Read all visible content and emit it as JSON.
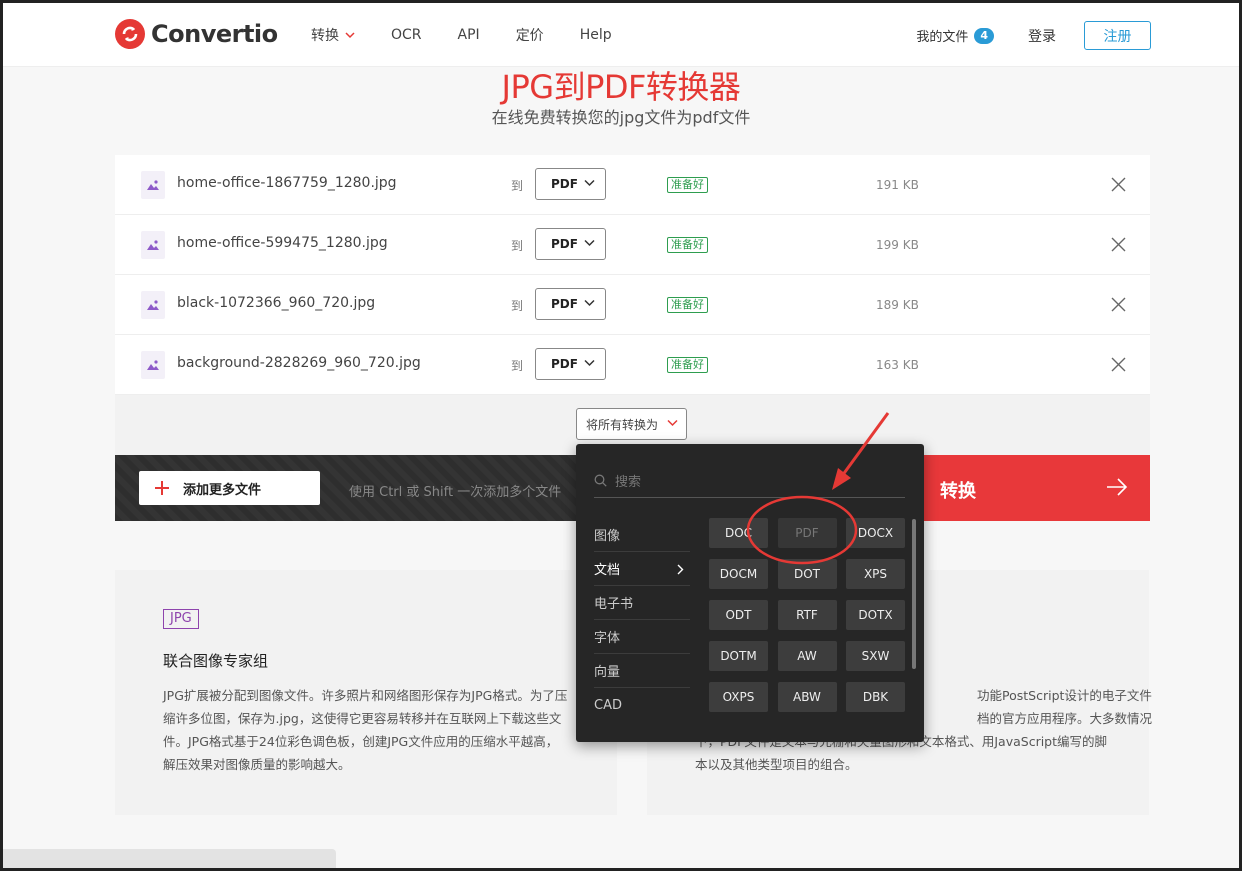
{
  "header": {
    "logo_text": "Convertio",
    "nav": [
      {
        "label": "转换",
        "has_dropdown": true
      },
      {
        "label": "OCR"
      },
      {
        "label": "API"
      },
      {
        "label": "定价"
      },
      {
        "label": "Help"
      }
    ],
    "my_files_label": "我的文件",
    "my_files_count": "4",
    "login_label": "登录",
    "register_label": "注册"
  },
  "page": {
    "title": "JPG到PDF转换器",
    "subtitle": "在线免费转换您的jpg文件为pdf文件"
  },
  "files": [
    {
      "name": "home-office-1867759_1280.jpg",
      "to": "到",
      "format": "PDF",
      "status": "准备好",
      "size": "191 KB"
    },
    {
      "name": "home-office-599475_1280.jpg",
      "to": "到",
      "format": "PDF",
      "status": "准备好",
      "size": "199 KB"
    },
    {
      "name": "black-1072366_960_720.jpg",
      "to": "到",
      "format": "PDF",
      "status": "准备好",
      "size": "189 KB"
    },
    {
      "name": "background-2828269_960_720.jpg",
      "to": "到",
      "format": "PDF",
      "status": "准备好",
      "size": "163 KB"
    }
  ],
  "convert_all_label": "将所有转换为",
  "action_bar": {
    "add_more_label": "添加更多文件",
    "hint": "使用 Ctrl 或 Shift 一次添加多个文件",
    "convert_label": "转换"
  },
  "dropdown": {
    "search_placeholder": "搜索",
    "categories": [
      {
        "label": "图像",
        "active": false
      },
      {
        "label": "文档",
        "active": true
      },
      {
        "label": "电子书",
        "active": false
      },
      {
        "label": "字体",
        "active": false
      },
      {
        "label": "向量",
        "active": false
      },
      {
        "label": "CAD",
        "active": false
      }
    ],
    "formats": [
      "DOC",
      "PDF",
      "DOCX",
      "DOCM",
      "DOT",
      "XPS",
      "ODT",
      "RTF",
      "DOTX",
      "DOTM",
      "AW",
      "SXW",
      "OXPS",
      "ABW",
      "DBK"
    ],
    "disabled_format": "PDF"
  },
  "cards": {
    "left": {
      "tag": "JPG",
      "title": "联合图像专家组",
      "text": "JPG扩展被分配到图像文件。许多照片和网络图形保存为JPG格式。为了压缩许多位图，保存为.jpg，这使得它更容易转移并在互联网上下载这些文件。JPG格式基于24位彩色调色板，创建JPG文件应用的压缩水平越高，解压效果对图像质量的影响越大。"
    },
    "right": {
      "line1": "功能PostScript设计的电子文件",
      "line2": "档的官方应用程序。大多数情况",
      "line3": "下，PDF文件是文本与光栅和矢量图形和文本格式、用JavaScript编写的脚",
      "line4": "本以及其他类型项目的组合。"
    }
  },
  "colors": {
    "brand_red": "#e53935",
    "accent_blue": "#2a9bd6",
    "ready_green": "#2e9d4f",
    "dark_panel": "#262626"
  }
}
